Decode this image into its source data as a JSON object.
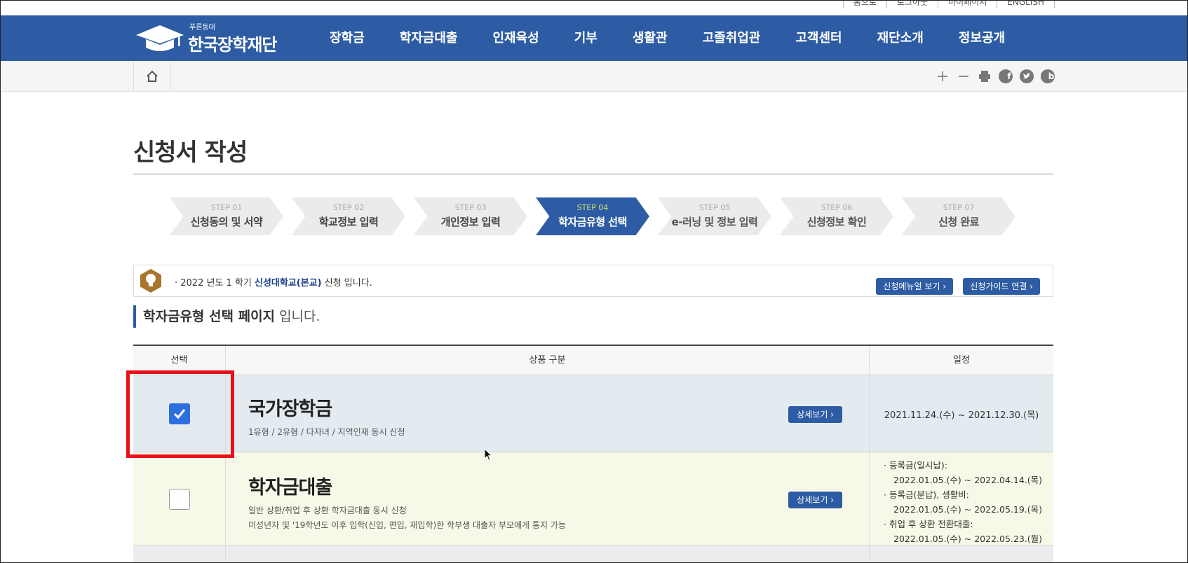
{
  "utility": [
    "홈으로",
    "로그아웃",
    "마이페이지",
    "ENGLISH"
  ],
  "logo": {
    "sub": "푸른등대",
    "name": "한국장학재단"
  },
  "gnb": [
    "장학금",
    "학자금대출",
    "인재육성",
    "기부",
    "생활관",
    "고졸취업관",
    "고객센터",
    "재단소개",
    "정보공개"
  ],
  "tools": {
    "plus": "+",
    "minus": "−",
    "b": "b"
  },
  "page_title": "신청서 작성",
  "steps": [
    {
      "num": "STEP 01",
      "label": "신청동의 및 서약"
    },
    {
      "num": "STEP 02",
      "label": "학교정보 입력"
    },
    {
      "num": "STEP 03",
      "label": "개인정보 입력"
    },
    {
      "num": "STEP 04",
      "label": "학자금유형 선택"
    },
    {
      "num": "STEP 05",
      "label": "e-러닝 및 정보 입력"
    },
    {
      "num": "STEP 06",
      "label": "신청정보 확인"
    },
    {
      "num": "STEP 07",
      "label": "신청 완료"
    }
  ],
  "notice": {
    "prefix": "· 2022 년도 1 학기 ",
    "school": "신성대학교(본교)",
    "suffix": " 신청 입니다.",
    "btn_manual": "신청메뉴얼 보기  ›",
    "btn_guide": "신청가이드 연결  ›"
  },
  "subtitle": {
    "bold": "학자금유형 선택 페이지",
    "rest": " 입니다."
  },
  "table": {
    "headers": [
      "선택",
      "상품 구분",
      "일정"
    ],
    "rows": [
      {
        "name": "국가장학금",
        "desc1": "1유형 / 2유형 / 다자녀 / 지역인재 동시 신청",
        "desc2": "",
        "detail": "상세보기  ›",
        "schedule": "2021.11.24.(수) ~ 2021.12.30.(목)",
        "checked": true
      },
      {
        "name": "학자금대출",
        "desc1": "일반 상환/취업 후 상환 학자금대출 동시 신청",
        "desc2": "미성년자 및 '19학년도 이후 입학(신입, 편입, 재입학)한 학부생 대출자 부모에게 통지 가능",
        "detail": "상세보기  ›",
        "schedule_lines": [
          {
            "h": "· 등록금(일시납):",
            "d": "2022.01.05.(수) ~ 2022.04.14.(목)"
          },
          {
            "h": "· 등록금(분납), 생활비:",
            "d": "2022.01.05.(수) ~ 2022.05.19.(목)"
          },
          {
            "h": "· 취업 후 상환 전환대출:",
            "d": "2022.01.05.(수) ~ 2022.05.23.(월)"
          }
        ],
        "checked": false
      }
    ]
  }
}
